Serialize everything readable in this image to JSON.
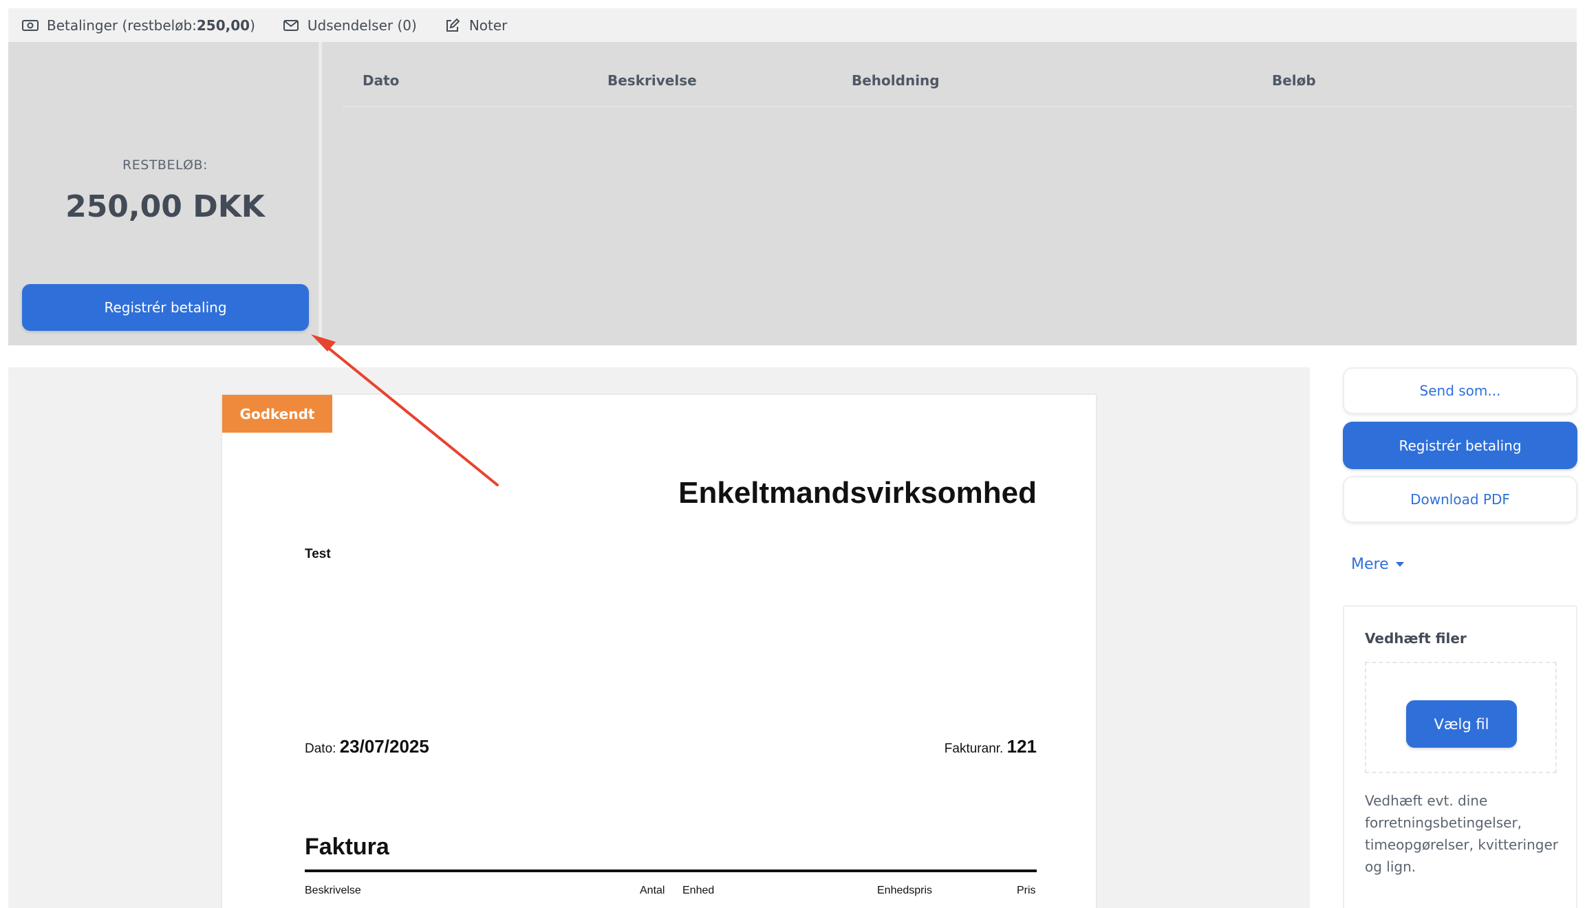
{
  "tabs": [
    {
      "label_prefix": "Betalinger (restbeløb: ",
      "label_bold": "250,00",
      "label_suffix": ")",
      "icon": "money-icon"
    },
    {
      "label": "Udsendelser (0)",
      "icon": "envelope-icon"
    },
    {
      "label": "Noter",
      "icon": "edit-icon"
    }
  ],
  "payments": {
    "rest_label": "RESTBELØB:",
    "rest_amount": "250,00 DKK",
    "register_button": "Registrér betaling",
    "columns": [
      "Dato",
      "Beskrivelse",
      "Beholdning",
      "Beløb"
    ]
  },
  "invoice": {
    "status_badge": "Godkendt",
    "company": "Enkeltmandsvirksomhed",
    "customer": "Test",
    "date_label": "Dato: ",
    "date_value": "23/07/2025",
    "number_label": "Fakturanr. ",
    "number_value": "121",
    "title": "Faktura",
    "columns": [
      "Beskrivelse",
      "Antal",
      "Enhed",
      "Enhedspris",
      "Pris"
    ]
  },
  "actions": {
    "send_as": "Send som...",
    "register_payment": "Registrér betaling",
    "download_pdf": "Download PDF",
    "more": "Mere"
  },
  "attach": {
    "title": "Vedhæft filer",
    "choose_button": "Vælg fil",
    "help_text": "Vedhæft evt. dine forretningsbetingelser, timeopgørelser, kvitteringer og lign."
  },
  "colors": {
    "primary": "#2f6fd9",
    "badge": "#ef8a3c",
    "annotation_arrow": "#e8432e"
  }
}
